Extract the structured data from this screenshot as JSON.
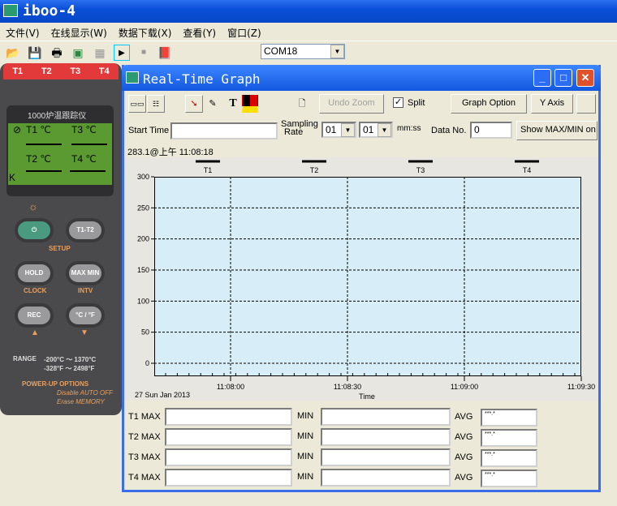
{
  "app": {
    "title": "iboo-4"
  },
  "menu": [
    "文件(V)",
    "在线显示(W)",
    "数据下载(X)",
    "查看(Y)",
    "窗口(Z)"
  ],
  "toolbar": {
    "icons": [
      "open-folder-icon",
      "save-icon",
      "print-icon",
      "connect-icon",
      "grid-icon",
      "play-icon",
      "stop-icon",
      "help-book-icon"
    ],
    "com_port": "COM18"
  },
  "device": {
    "channels": [
      "T1",
      "T2",
      "T3",
      "T4"
    ],
    "lcd_title": "1000炉温跟踪仪",
    "lcd_labels": [
      "T1 ℃",
      "T3 ℃",
      "T2 ℃",
      "T4 ℃"
    ],
    "thermocouple": "K",
    "buttons": {
      "power": "⏻",
      "t1t2": "T1-T2",
      "hold": "HOLD",
      "maxmin": "MAX MIN",
      "rec": "REC",
      "unit": "°C / °F"
    },
    "setup": "SETUP",
    "clock": "CLOCK",
    "intv": "INTV",
    "range_label": "RANGE",
    "range_c": "-200°C ～ 1370°C",
    "range_f": "-328°F ～ 2498°F",
    "power_up": "POWER-UP OPTIONS",
    "opt1": "Disable AUTO OFF",
    "opt2": "Erase MEMORY"
  },
  "child": {
    "title": "Real-Time Graph",
    "toolbar": {
      "undo_zoom": "Undo Zoom",
      "split_label": "Split",
      "split_checked": true,
      "graph_option": "Graph Option",
      "y_axis": "Y Axis"
    },
    "row2": {
      "start_time_label": "Start Time",
      "start_time": "",
      "sampling_label1": "Sampling",
      "sampling_label2": "Rate",
      "rate_min": "01",
      "rate_sec": "01",
      "rate_unit": "mm:ss",
      "data_no_label": "Data No.",
      "data_no": "0",
      "show_maxmin": "Show MAX/MIN on"
    },
    "readout": "283.1@上午 11:08:18",
    "date": "27 Sun Jan 2013"
  },
  "chart_data": {
    "type": "line",
    "legend": [
      "T1",
      "T2",
      "T3",
      "T4"
    ],
    "xlabel": "Time",
    "ylabel": "",
    "ylim": [
      0,
      300
    ],
    "yticks": [
      "300",
      "250",
      "200",
      "150",
      "100",
      "50",
      "0"
    ],
    "xticks": [
      "11:08:00",
      "11:08:30",
      "11:09:00",
      "11:09:30"
    ],
    "grid": true,
    "series": []
  },
  "stats": {
    "rows": [
      {
        "label": "T1 MAX",
        "max": "",
        "min": "",
        "avg": "***.*"
      },
      {
        "label": "T2 MAX",
        "max": "",
        "min": "",
        "avg": "***.*"
      },
      {
        "label": "T3 MAX",
        "max": "",
        "min": "",
        "avg": "***.*"
      },
      {
        "label": "T4 MAX",
        "max": "",
        "min": "",
        "avg": "***.*"
      }
    ],
    "min_label": "MIN",
    "avg_label": "AVG"
  }
}
